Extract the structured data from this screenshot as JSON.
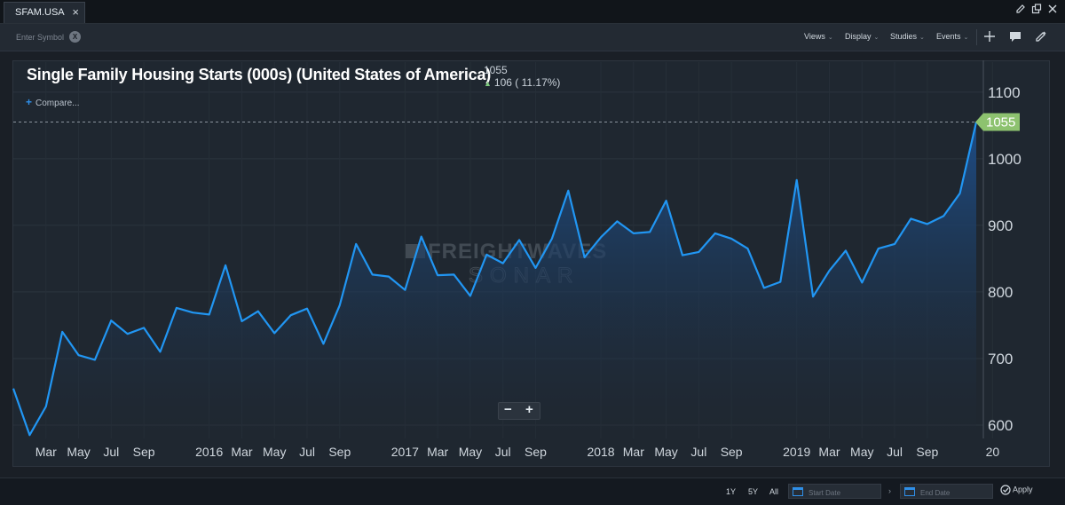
{
  "tab": {
    "label": "SFAM.USA",
    "close": "×"
  },
  "toolbar": {
    "symbol_placeholder": "Enter Symbol",
    "clear_label": "X",
    "menus": [
      "Views",
      "Display",
      "Studies",
      "Events"
    ]
  },
  "header": {
    "title": "Single Family Housing Starts (000s) (United States of America)",
    "last_value": "1055",
    "change": "106 ( 11.17%)",
    "compare_label": "Compare..."
  },
  "watermark": {
    "line1": "FREIGHTWAVES",
    "line2": "SONAR"
  },
  "zoom": {
    "minus": "−",
    "plus": "+"
  },
  "bottom": {
    "ranges": [
      "1Y",
      "5Y",
      "All"
    ],
    "start_placeholder": "Start Date",
    "end_placeholder": "End Date",
    "apply_label": "Apply"
  },
  "colors": {
    "line": "#2196f3",
    "fill_top": "#1d4f8c",
    "fill_bottom": "#1f2730",
    "price_tag": "#8dc26f"
  },
  "chart_data": {
    "type": "area",
    "title": "Single Family Housing Starts (000s) (United States of America)",
    "ylabel": "",
    "ylim": [
      580,
      1145
    ],
    "yticks": [
      600,
      700,
      800,
      900,
      1000,
      1100
    ],
    "x_tick_labels": [
      "Mar",
      "May",
      "Jul",
      "Sep",
      "2016",
      "Mar",
      "May",
      "Jul",
      "Sep",
      "2017",
      "Mar",
      "May",
      "Jul",
      "Sep",
      "2018",
      "Mar",
      "May",
      "Jul",
      "Sep",
      "2019",
      "Mar",
      "May",
      "Jul",
      "Sep",
      "20"
    ],
    "x_tick_months": [
      2,
      4,
      6,
      8,
      12,
      14,
      16,
      18,
      20,
      24,
      26,
      28,
      30,
      32,
      36,
      38,
      40,
      42,
      44,
      48,
      50,
      52,
      54,
      56,
      60
    ],
    "last_price_label": "1055",
    "grid": true,
    "series": [
      {
        "values": [
          655,
          585,
          628,
          740,
          705,
          698,
          757,
          737,
          746,
          710,
          776,
          769,
          766,
          840,
          756,
          771,
          738,
          765,
          775,
          722,
          780,
          872,
          826,
          823,
          803,
          883,
          825,
          826,
          794,
          856,
          843,
          878,
          836,
          880,
          952,
          852,
          882,
          906,
          888,
          890,
          937,
          855,
          860,
          888,
          880,
          865,
          806,
          815,
          968,
          793,
          832,
          862,
          814,
          865,
          872,
          910,
          902,
          914,
          948,
          1055
        ]
      }
    ]
  }
}
